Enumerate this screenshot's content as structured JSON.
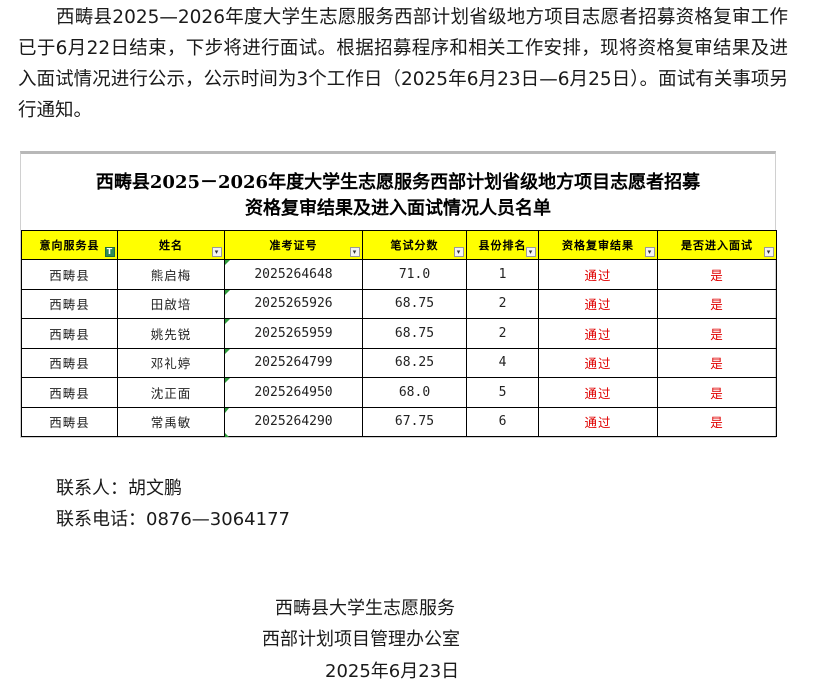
{
  "intro": "西畴县2025—2026年度大学生志愿服务西部计划省级地方项目志愿者招募资格复审工作已于6月22日结束，下步将进行面试。根据招募程序和相关工作安排，现将资格复审结果及进入面试情况进行公示，公示时间为3个工作日（2025年6月23日—6月25日）。面试有关事项另行通知。",
  "sheet": {
    "title_line1": "西畴县2025－2026年度大学生志愿服务西部计划省级地方项目志愿者招募",
    "title_line2": "资格复审结果及进入面试情况人员名单",
    "headers": [
      "意向服务县",
      "姓名",
      "准考证号",
      "笔试分数",
      "县份排名",
      "资格复审结果",
      "是否进入面试"
    ],
    "rows": [
      {
        "county": "西畴县",
        "name": "熊启梅",
        "id": "2025264648",
        "score": "71.0",
        "rank": "1",
        "review": "通过",
        "interview": "是"
      },
      {
        "county": "西畴县",
        "name": "田啟培",
        "id": "2025265926",
        "score": "68.75",
        "rank": "2",
        "review": "通过",
        "interview": "是"
      },
      {
        "county": "西畴县",
        "name": "姚先锐",
        "id": "2025265959",
        "score": "68.75",
        "rank": "2",
        "review": "通过",
        "interview": "是"
      },
      {
        "county": "西畴县",
        "name": "邓礼婷",
        "id": "2025264799",
        "score": "68.25",
        "rank": "4",
        "review": "通过",
        "interview": "是"
      },
      {
        "county": "西畴县",
        "name": "沈正面",
        "id": "2025264950",
        "score": "68.0",
        "rank": "5",
        "review": "通过",
        "interview": "是"
      },
      {
        "county": "西畴县",
        "name": "常禹敏",
        "id": "2025264290",
        "score": "67.75",
        "rank": "6",
        "review": "通过",
        "interview": "是"
      }
    ]
  },
  "contact": {
    "person": "联系人：胡文鹏",
    "phone": "联系电话：0876—3064177"
  },
  "signature": {
    "org_line1": "西畴县大学生志愿服务",
    "org_line2": "西部计划项目管理办公室",
    "date": "2025年6月23日"
  }
}
